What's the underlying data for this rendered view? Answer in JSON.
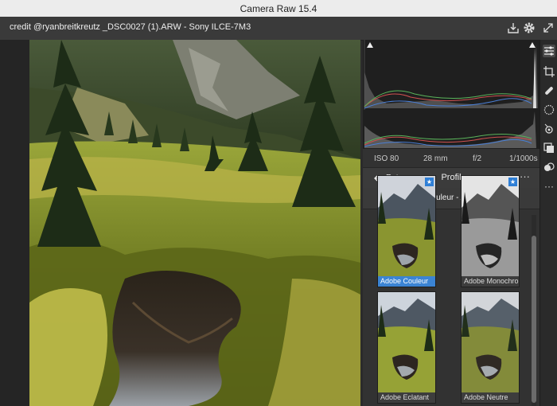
{
  "window": {
    "title": "Camera Raw 15.4"
  },
  "header": {
    "file_info": "credit @ryanbreitkreutz _DSC0027 (1).ARW  -  Sony ILCE-7M3"
  },
  "exif": {
    "iso": "ISO 80",
    "focal": "28 mm",
    "aperture": "f/2",
    "shutter": "1/1000s"
  },
  "profile_panel": {
    "back_label": "Retour",
    "title": "Profil",
    "current_profile": "Adobe Couleur - Adobe Raw",
    "more_icon": "ellipsis-icon",
    "thumbnails": [
      {
        "label": "Adobe Couleur",
        "selected": true,
        "favorite": true
      },
      {
        "label": "Adobe Monochrome",
        "selected": false,
        "favorite": true
      },
      {
        "label": "Adobe Eclatant",
        "selected": false,
        "favorite": false
      },
      {
        "label": "Adobe Neutre",
        "selected": false,
        "favorite": false
      }
    ]
  },
  "toolbar": {
    "tools": [
      "edit-sliders-icon",
      "crop-icon",
      "heal-icon",
      "mask-icon",
      "redeye-icon",
      "snapshots-icon",
      "presets-icon",
      "more-icon"
    ],
    "active_tool": "edit-sliders-icon"
  },
  "colors": {
    "accent": "#3b84d4",
    "panel": "#323232",
    "header": "#3a3a3a"
  }
}
